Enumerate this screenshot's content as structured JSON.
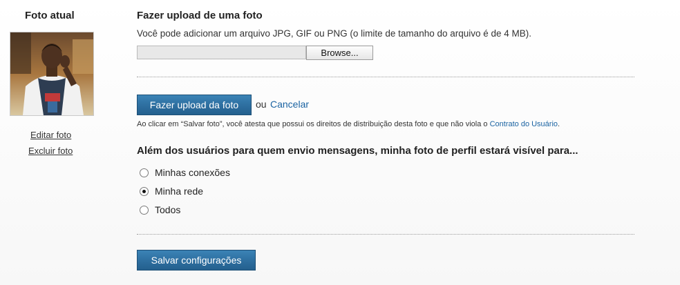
{
  "current_photo": {
    "heading": "Foto atual",
    "edit_link": "Editar foto",
    "delete_link": "Excluir foto"
  },
  "upload": {
    "title": "Fazer upload de uma foto",
    "description": "Você pode adicionar um arquivo JPG, GIF ou PNG (o limite de tamanho do arquivo é de 4 MB).",
    "file_value": "",
    "browse_label": "Browse...",
    "upload_button": "Fazer upload da foto",
    "or_text": "ou",
    "cancel_link": "Cancelar",
    "legal_text": "Ao clicar em “Salvar foto”, você atesta que possui os direitos de distribuição desta foto e que não viola o",
    "legal_link": "Contrato do Usuário",
    "legal_end": "."
  },
  "visibility": {
    "title": "Além dos usuários para quem envio mensagens, minha foto de perfil estará visível para...",
    "options": [
      {
        "label": "Minhas conexões",
        "checked": false
      },
      {
        "label": "Minha rede",
        "checked": true
      },
      {
        "label": "Todos",
        "checked": false
      }
    ]
  },
  "save_button": "Salvar configurações",
  "colors": {
    "link": "#1a63a2",
    "button": "#2d6e9f"
  }
}
